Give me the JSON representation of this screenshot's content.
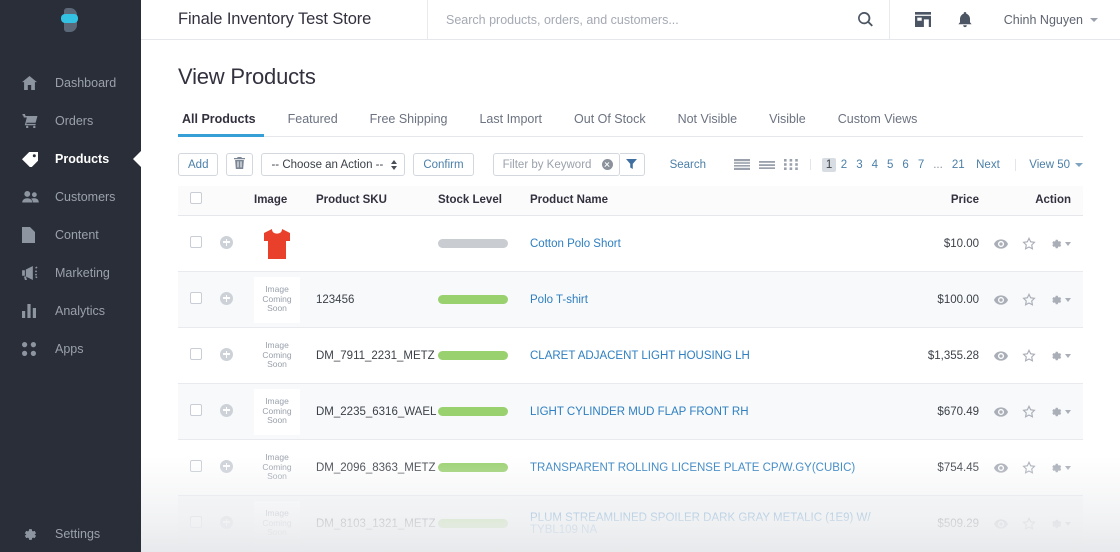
{
  "sidebar": {
    "logo_name": "bigcommerce-logo",
    "items": [
      {
        "label": "Dashboard",
        "icon": "home-icon",
        "active": false
      },
      {
        "label": "Orders",
        "icon": "cart-icon",
        "active": false
      },
      {
        "label": "Products",
        "icon": "tag-icon",
        "active": true
      },
      {
        "label": "Customers",
        "icon": "users-icon",
        "active": false
      },
      {
        "label": "Content",
        "icon": "document-icon",
        "active": false
      },
      {
        "label": "Marketing",
        "icon": "megaphone-icon",
        "active": false
      },
      {
        "label": "Analytics",
        "icon": "bar-chart-icon",
        "active": false
      },
      {
        "label": "Apps",
        "icon": "apps-grid-icon",
        "active": false
      }
    ],
    "settings_label": "Settings"
  },
  "header": {
    "store_title": "Finale Inventory Test Store",
    "search_placeholder": "Search products, orders, and customers...",
    "search_value": "",
    "icons": [
      "search-icon",
      "storefront-icon",
      "bell-icon"
    ],
    "user_name": "Chinh Nguyen"
  },
  "page": {
    "title": "View Products"
  },
  "tabs": [
    {
      "label": "All Products",
      "active": true
    },
    {
      "label": "Featured",
      "active": false
    },
    {
      "label": "Free Shipping",
      "active": false
    },
    {
      "label": "Last Import",
      "active": false
    },
    {
      "label": "Out Of Stock",
      "active": false
    },
    {
      "label": "Not Visible",
      "active": false
    },
    {
      "label": "Visible",
      "active": false
    },
    {
      "label": "Custom Views",
      "active": false
    }
  ],
  "toolbar": {
    "add_label": "Add",
    "delete_icon": "trash-icon",
    "action_select_value": "-- Choose an Action --",
    "confirm_label": "Confirm",
    "filter_placeholder": "Filter by Keyword",
    "filter_value": "",
    "clear_icon": "clear-circle-icon",
    "funnel_icon": "funnel-icon",
    "search_label": "Search"
  },
  "viewmodes": [
    {
      "icon": "list-view-icon",
      "active": true
    },
    {
      "icon": "compact-view-icon",
      "active": false
    },
    {
      "icon": "grid-view-icon",
      "active": false
    }
  ],
  "pagination": {
    "pages": [
      "1",
      "2",
      "3",
      "4",
      "5",
      "6",
      "7",
      "...",
      "21"
    ],
    "current": "1",
    "next_label": "Next",
    "view_count_label": "View 50"
  },
  "table": {
    "headers": {
      "image": "Image",
      "sku": "Product SKU",
      "stock": "Stock Level",
      "name": "Product Name",
      "price": "Price",
      "action": "Action"
    },
    "rows": [
      {
        "sku": "",
        "image_type": "red-shirt-thumbnail",
        "image_placeholder": "",
        "stock_color": "gray",
        "name": "Cotton Polo Short",
        "price": "$10.00"
      },
      {
        "sku": "123456",
        "image_type": "placeholder",
        "image_placeholder": "Image Coming Soon",
        "stock_color": "green",
        "name": "Polo T-shirt",
        "price": "$100.00"
      },
      {
        "sku": "DM_7911_2231_METZ",
        "image_type": "placeholder",
        "image_placeholder": "Image Coming Soon",
        "stock_color": "green",
        "name": "CLARET ADJACENT LIGHT HOUSING LH",
        "price": "$1,355.28"
      },
      {
        "sku": "DM_2235_6316_WAEL",
        "image_type": "placeholder",
        "image_placeholder": "Image Coming Soon",
        "stock_color": "green",
        "name": "LIGHT CYLINDER MUD FLAP FRONT RH",
        "price": "$670.49"
      },
      {
        "sku": "DM_2096_8363_METZ",
        "image_type": "placeholder",
        "image_placeholder": "Image Coming Soon",
        "stock_color": "green",
        "name": "TRANSPARENT ROLLING LICENSE PLATE CP/W.GY(CUBIC)",
        "price": "$754.45"
      },
      {
        "sku": "DM_8103_1321_METZ",
        "image_type": "placeholder",
        "image_placeholder": "Image Coming Soon",
        "stock_color": "green",
        "name": "PLUM STREAMLINED SPOILER DARK GRAY METALIC (1E9) W/ TYBL109 NA",
        "price": "$509.29"
      }
    ],
    "row_icons": {
      "preview": "eye-icon",
      "favorite": "star-icon",
      "settings": "gear-icon"
    }
  },
  "colors": {
    "sidebar_bg": "#2a2e38",
    "accent_blue": "#36a0d6",
    "link_blue": "#2e7fc1",
    "stock_green": "#9ad16f",
    "stock_gray": "#c9ccd1",
    "shirt_red": "#e8402a"
  }
}
